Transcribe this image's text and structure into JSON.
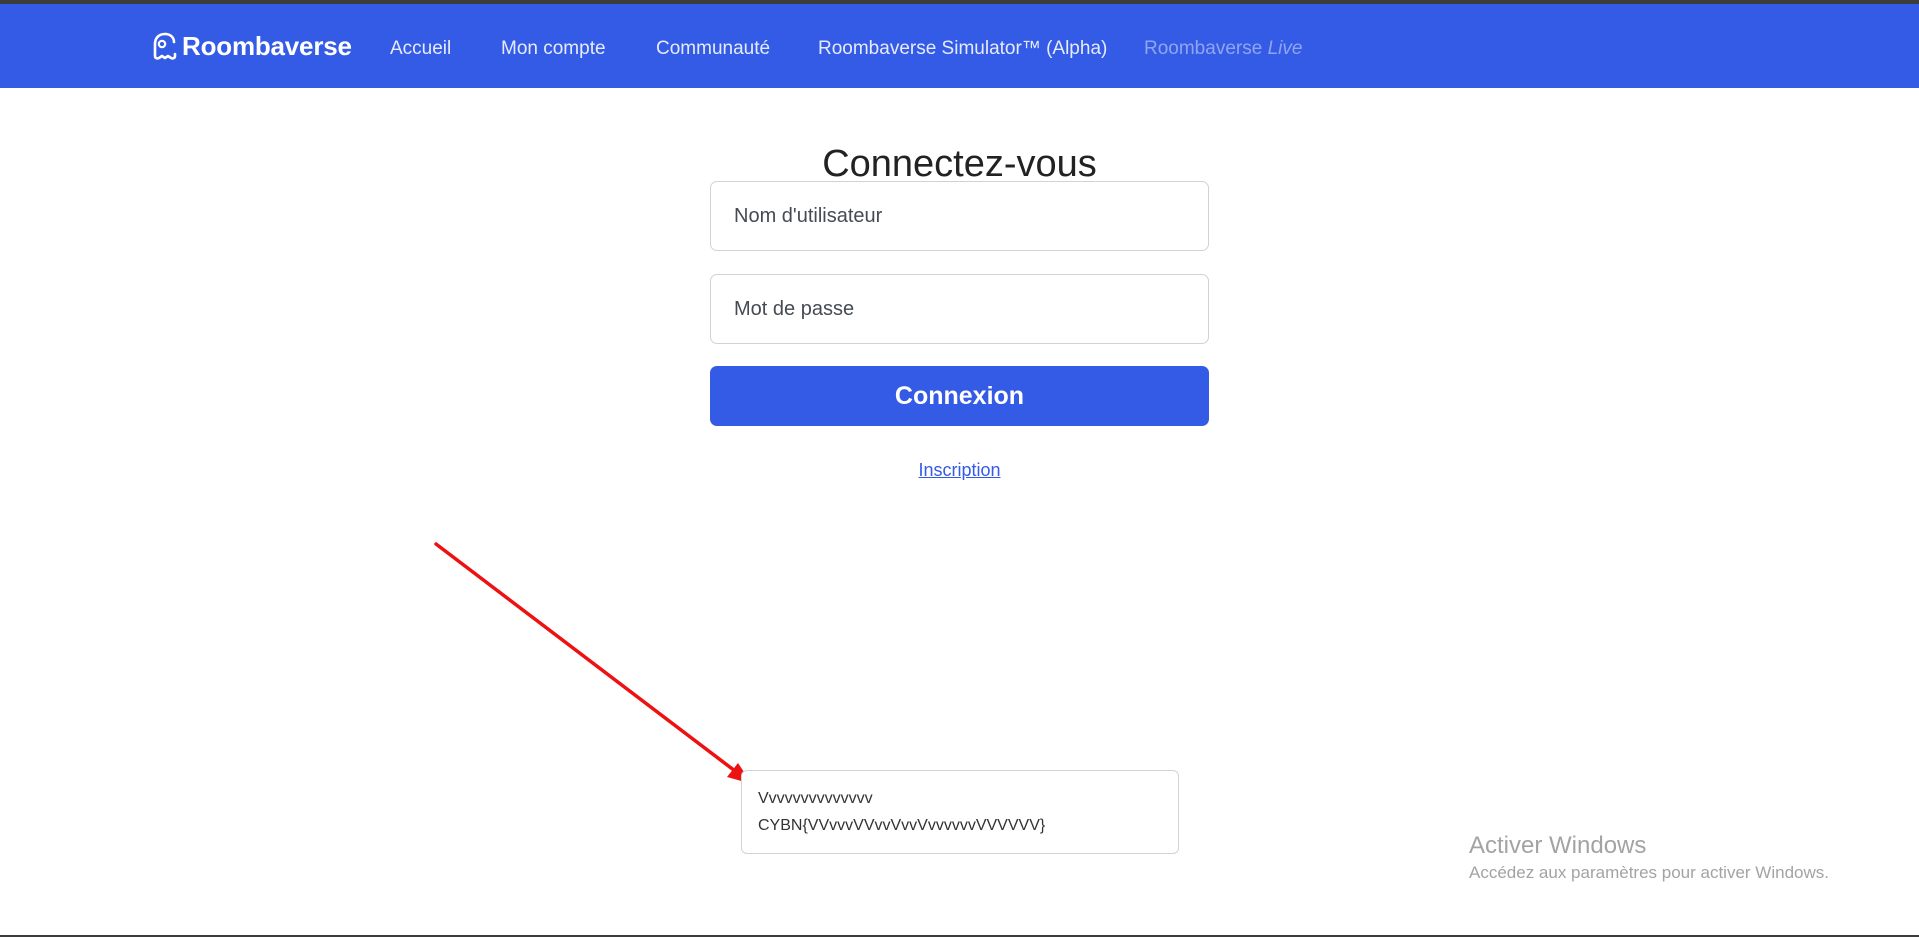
{
  "navbar": {
    "brand": "Roombaverse",
    "links": [
      {
        "label": "Accueil"
      },
      {
        "label": "Mon compte"
      },
      {
        "label": "Communauté"
      },
      {
        "label": "Roombaverse Simulator™ (Alpha)"
      }
    ],
    "disabled_link": {
      "prefix": "Roombaverse",
      "suffix": "Live"
    },
    "background_color": "#345be6"
  },
  "login": {
    "title": "Connectez-vous",
    "username_placeholder": "Nom d'utilisateur",
    "password_placeholder": "Mot de passe",
    "submit_label": "Connexion",
    "register_link": "Inscription"
  },
  "annotation": {
    "arrow_color": "#ee1111",
    "note_line1": "Vvvvvvvvvvvvvv",
    "note_line2": "CYBN{VVvvvVVvvVvvVvvvvvvVVVVVV}"
  },
  "windows_watermark": {
    "title": "Activer Windows",
    "subtitle": "Accédez aux paramètres pour activer Windows."
  }
}
